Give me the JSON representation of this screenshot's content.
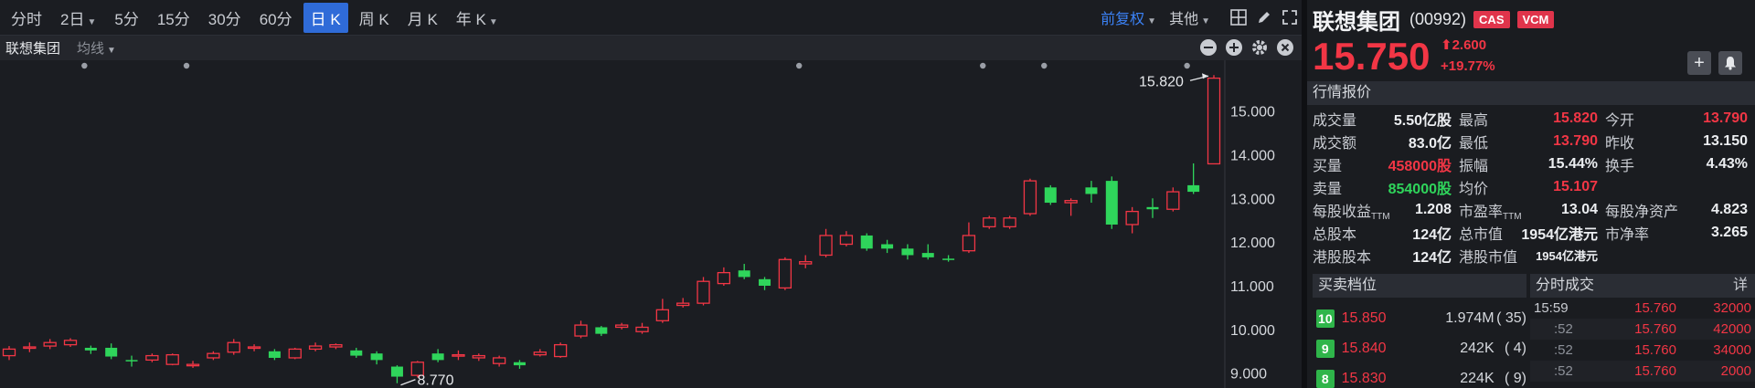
{
  "toolbar": {
    "periods": [
      {
        "label": "分时",
        "caret": false,
        "active": false
      },
      {
        "label": "2日",
        "caret": true,
        "active": false
      },
      {
        "label": "5分",
        "caret": false,
        "active": false
      },
      {
        "label": "15分",
        "caret": false,
        "active": false
      },
      {
        "label": "30分",
        "caret": false,
        "active": false
      },
      {
        "label": "60分",
        "caret": false,
        "active": false
      },
      {
        "label": "日 K",
        "caret": false,
        "active": true
      },
      {
        "label": "周 K",
        "caret": false,
        "active": false
      },
      {
        "label": "月 K",
        "caret": false,
        "active": false
      },
      {
        "label": "年 K",
        "caret": true,
        "active": false
      }
    ],
    "adjust_label": "前复权",
    "other_label": "其他"
  },
  "subbar": {
    "title": "联想集团",
    "ma_label": "均线"
  },
  "chart_data": {
    "type": "candlestick",
    "y_ticks": [
      "15.000",
      "14.000",
      "13.000",
      "12.000",
      "11.000",
      "10.000",
      "9.000"
    ],
    "y_tick_values": [
      15,
      14,
      13,
      12,
      11,
      10,
      9
    ],
    "high_annotation": "15.820",
    "low_annotation": "8.770",
    "candles": [
      {
        "o": 9.4,
        "c": 9.55,
        "h": 9.62,
        "l": 9.3
      },
      {
        "o": 9.58,
        "c": 9.6,
        "h": 9.7,
        "l": 9.48
      },
      {
        "o": 9.62,
        "c": 9.7,
        "h": 9.78,
        "l": 9.55
      },
      {
        "o": 9.65,
        "c": 9.75,
        "h": 9.8,
        "l": 9.6
      },
      {
        "o": 9.58,
        "c": 9.52,
        "h": 9.63,
        "l": 9.44
      },
      {
        "o": 9.58,
        "c": 9.38,
        "h": 9.68,
        "l": 9.32
      },
      {
        "o": 9.3,
        "c": 9.28,
        "h": 9.4,
        "l": 9.15
      },
      {
        "o": 9.3,
        "c": 9.4,
        "h": 9.45,
        "l": 9.25
      },
      {
        "o": 9.2,
        "c": 9.42,
        "h": 9.45,
        "l": 9.18
      },
      {
        "o": 9.2,
        "c": 9.2,
        "h": 9.28,
        "l": 9.12
      },
      {
        "o": 9.35,
        "c": 9.45,
        "h": 9.5,
        "l": 9.3
      },
      {
        "o": 9.48,
        "c": 9.7,
        "h": 9.78,
        "l": 9.42
      },
      {
        "o": 9.58,
        "c": 9.6,
        "h": 9.66,
        "l": 9.5
      },
      {
        "o": 9.5,
        "c": 9.35,
        "h": 9.55,
        "l": 9.3
      },
      {
        "o": 9.35,
        "c": 9.55,
        "h": 9.58,
        "l": 9.32
      },
      {
        "o": 9.55,
        "c": 9.62,
        "h": 9.7,
        "l": 9.5
      },
      {
        "o": 9.6,
        "c": 9.65,
        "h": 9.68,
        "l": 9.55
      },
      {
        "o": 9.52,
        "c": 9.4,
        "h": 9.58,
        "l": 9.35
      },
      {
        "o": 9.45,
        "c": 9.3,
        "h": 9.5,
        "l": 9.2
      },
      {
        "o": 9.15,
        "c": 8.92,
        "h": 9.18,
        "l": 8.77
      },
      {
        "o": 8.95,
        "c": 9.25,
        "h": 9.28,
        "l": 8.9
      },
      {
        "o": 9.45,
        "c": 9.3,
        "h": 9.55,
        "l": 9.25
      },
      {
        "o": 9.4,
        "c": 9.42,
        "h": 9.52,
        "l": 9.3
      },
      {
        "o": 9.35,
        "c": 9.4,
        "h": 9.45,
        "l": 9.28
      },
      {
        "o": 9.22,
        "c": 9.35,
        "h": 9.4,
        "l": 9.15
      },
      {
        "o": 9.25,
        "c": 9.18,
        "h": 9.3,
        "l": 9.1
      },
      {
        "o": 9.42,
        "c": 9.48,
        "h": 9.55,
        "l": 9.38
      },
      {
        "o": 9.38,
        "c": 9.65,
        "h": 9.7,
        "l": 9.35
      },
      {
        "o": 9.85,
        "c": 10.1,
        "h": 10.2,
        "l": 9.8
      },
      {
        "o": 10.05,
        "c": 9.9,
        "h": 10.08,
        "l": 9.85
      },
      {
        "o": 10.05,
        "c": 10.1,
        "h": 10.15,
        "l": 10.0
      },
      {
        "o": 9.95,
        "c": 10.05,
        "h": 10.15,
        "l": 9.9
      },
      {
        "o": 10.2,
        "c": 10.45,
        "h": 10.7,
        "l": 10.15
      },
      {
        "o": 10.55,
        "c": 10.6,
        "h": 10.72,
        "l": 10.5
      },
      {
        "o": 10.6,
        "c": 11.1,
        "h": 11.2,
        "l": 10.55
      },
      {
        "o": 11.05,
        "c": 11.3,
        "h": 11.42,
        "l": 11.0
      },
      {
        "o": 11.35,
        "c": 11.2,
        "h": 11.5,
        "l": 11.15
      },
      {
        "o": 11.15,
        "c": 11.0,
        "h": 11.2,
        "l": 10.9
      },
      {
        "o": 10.95,
        "c": 11.6,
        "h": 11.65,
        "l": 10.9
      },
      {
        "o": 11.5,
        "c": 11.55,
        "h": 11.7,
        "l": 11.4
      },
      {
        "o": 11.7,
        "c": 12.15,
        "h": 12.3,
        "l": 11.65
      },
      {
        "o": 11.95,
        "c": 12.15,
        "h": 12.25,
        "l": 11.9
      },
      {
        "o": 12.15,
        "c": 11.85,
        "h": 12.2,
        "l": 11.8
      },
      {
        "o": 11.95,
        "c": 11.85,
        "h": 12.05,
        "l": 11.75
      },
      {
        "o": 11.85,
        "c": 11.7,
        "h": 11.95,
        "l": 11.6
      },
      {
        "o": 11.75,
        "c": 11.65,
        "h": 11.95,
        "l": 11.6
      },
      {
        "o": 11.62,
        "c": 11.6,
        "h": 11.7,
        "l": 11.55
      },
      {
        "o": 11.8,
        "c": 12.15,
        "h": 12.45,
        "l": 11.75
      },
      {
        "o": 12.35,
        "c": 12.55,
        "h": 12.6,
        "l": 12.3
      },
      {
        "o": 12.35,
        "c": 12.55,
        "h": 12.6,
        "l": 12.3
      },
      {
        "o": 12.65,
        "c": 13.4,
        "h": 13.45,
        "l": 12.6
      },
      {
        "o": 13.25,
        "c": 12.9,
        "h": 13.3,
        "l": 12.85
      },
      {
        "o": 12.9,
        "c": 12.95,
        "h": 13.0,
        "l": 12.6
      },
      {
        "o": 13.25,
        "c": 13.1,
        "h": 13.4,
        "l": 12.9
      },
      {
        "o": 13.4,
        "c": 12.4,
        "h": 13.5,
        "l": 12.3
      },
      {
        "o": 12.4,
        "c": 12.7,
        "h": 12.8,
        "l": 12.2
      },
      {
        "o": 12.8,
        "c": 12.75,
        "h": 13.0,
        "l": 12.55
      },
      {
        "o": 12.75,
        "c": 13.15,
        "h": 13.25,
        "l": 12.7
      },
      {
        "o": 13.3,
        "c": 13.15,
        "h": 13.8,
        "l": 13.1
      },
      {
        "o": 13.79,
        "c": 15.75,
        "h": 15.82,
        "l": 13.79
      }
    ],
    "marker_indices": [
      1,
      6,
      36,
      45,
      48,
      55
    ],
    "ylim": [
      8.66,
      16.16
    ]
  },
  "header": {
    "name": "联想集团",
    "code": "(00992)",
    "badges": [
      "CAS",
      "VCM"
    ],
    "price": "15.750",
    "change": "2.600",
    "change_pct": "+19.77%"
  },
  "quote": {
    "title": "行情报价",
    "rows": [
      [
        {
          "label": "成交量",
          "value": "5.50亿股",
          "color": "white"
        },
        {
          "label": "最高",
          "value": "15.820",
          "color": "red"
        },
        {
          "label": "今开",
          "value": "13.790",
          "color": "red"
        }
      ],
      [
        {
          "label": "成交额",
          "value": "83.0亿",
          "color": "white"
        },
        {
          "label": "最低",
          "value": "13.790",
          "color": "red"
        },
        {
          "label": "昨收",
          "value": "13.150",
          "color": "white"
        }
      ],
      [
        {
          "label": "买量",
          "value": "458000股",
          "color": "red"
        },
        {
          "label": "振幅",
          "value": "15.44%",
          "color": "white"
        },
        {
          "label": "换手",
          "value": "4.43%",
          "color": "white"
        }
      ],
      [
        {
          "label": "卖量",
          "value": "854000股",
          "color": "green"
        },
        {
          "label": "均价",
          "value": "15.107",
          "color": "red"
        },
        {
          "label": "",
          "value": "",
          "color": "white"
        }
      ],
      [
        {
          "label": "每股收益",
          "sub": "TTM",
          "value": "1.208",
          "color": "white"
        },
        {
          "label": "市盈率",
          "sub": "TTM",
          "value": "13.04",
          "color": "white"
        },
        {
          "label": "每股净资产",
          "value": "4.823",
          "color": "white"
        }
      ],
      [
        {
          "label": "总股本",
          "value": "124亿",
          "color": "white"
        },
        {
          "label": "总市值",
          "value": "1954亿港元",
          "color": "white"
        },
        {
          "label": "市净率",
          "value": "3.265",
          "color": "white"
        }
      ],
      [
        {
          "label": "港股股本",
          "value": "124亿",
          "color": "white"
        },
        {
          "label": "港股市值",
          "value": "1954亿港元",
          "color": "white",
          "small": true
        },
        {
          "label": "",
          "value": "",
          "color": "white"
        }
      ]
    ]
  },
  "depth": {
    "title": "买卖档位",
    "rows": [
      {
        "level": "10",
        "price": "15.850",
        "vol": "1.974M",
        "count": "( 35)"
      },
      {
        "level": "9",
        "price": "15.840",
        "vol": "242K",
        "count": "( 4)"
      },
      {
        "level": "8",
        "price": "15.830",
        "vol": "224K",
        "count": "( 9)"
      }
    ]
  },
  "trades": {
    "title": "分时成交",
    "detail_label": "详",
    "rows": [
      {
        "time": "15:59",
        "price": "15.760",
        "vol": "32000"
      },
      {
        "time": ":52",
        "price": "15.760",
        "vol": "42000"
      },
      {
        "time": ":52",
        "price": "15.760",
        "vol": "34000"
      },
      {
        "time": ":52",
        "price": "15.760",
        "vol": "2000"
      }
    ]
  },
  "colors": {
    "up": "#f23645",
    "down": "#2fd55b",
    "accent": "#2f6bd8"
  }
}
